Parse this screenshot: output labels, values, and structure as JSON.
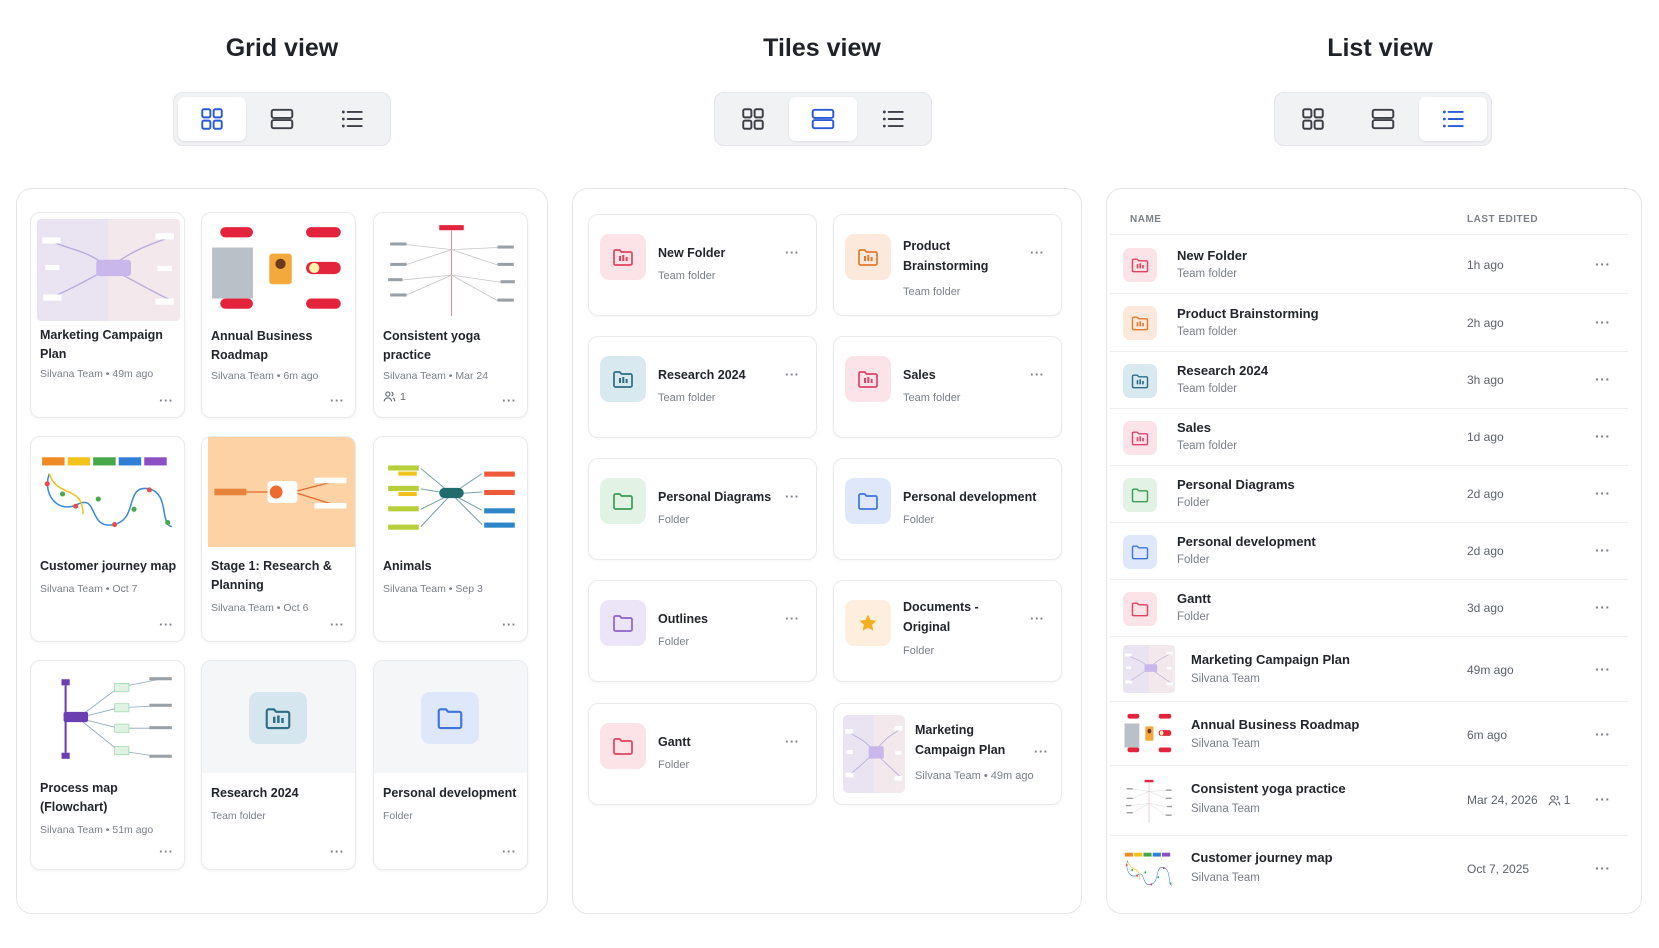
{
  "columns": {
    "grid": {
      "title": "Grid view"
    },
    "tiles": {
      "title": "Tiles view"
    },
    "list": {
      "title": "List view"
    }
  },
  "view_switcher": {
    "options": [
      "grid",
      "tiles",
      "list"
    ],
    "icons": [
      "grid-view-icon",
      "tiles-view-icon",
      "list-view-icon"
    ],
    "active_color": "#2a5bd7",
    "inactive_color": "#3b3f46"
  },
  "colors": {
    "red_folder": "#e0435e",
    "orange_folder": "#e07a2e",
    "teal_folder": "#2d6e87",
    "green_folder": "#3a9a56",
    "blue_folder": "#3f74d8",
    "purple_folder": "#8c63c9",
    "star": "#f2b01e"
  },
  "grid_view": {
    "cards": [
      {
        "title": "Marketing Campaign Plan",
        "meta": "Silvana Team • 49m ago"
      },
      {
        "title": "Annual Business Roadmap",
        "meta": "Silvana Team • 6m ago"
      },
      {
        "title": "Consistent yoga practice",
        "meta": "Silvana Team • Mar 24",
        "shared": "1"
      },
      {
        "title": "Customer journey map",
        "meta": "Silvana Team • Oct 7"
      },
      {
        "title": "Stage 1: Research & Planning",
        "meta": "Silvana Team • Oct 6"
      },
      {
        "title": "Animals",
        "meta": "Silvana Team • Sep 3"
      },
      {
        "title": "Process map (Flowchart)",
        "meta": "Silvana Team • 51m ago"
      },
      {
        "title": "Research 2024",
        "meta": "Team folder"
      },
      {
        "title": "Personal development",
        "meta": "Folder"
      }
    ]
  },
  "tiles_view": {
    "tiles": [
      {
        "title": "New Folder",
        "meta": "Team folder"
      },
      {
        "title": "Product Brainstorming",
        "meta": "Team folder"
      },
      {
        "title": "Research 2024",
        "meta": "Team folder"
      },
      {
        "title": "Sales",
        "meta": "Team folder"
      },
      {
        "title": "Personal Diagrams",
        "meta": "Folder"
      },
      {
        "title": "Personal development",
        "meta": "Folder"
      },
      {
        "title": "Outlines",
        "meta": "Folder"
      },
      {
        "title": "Documents - Original",
        "meta": "Folder"
      },
      {
        "title": "Gantt",
        "meta": "Folder"
      },
      {
        "title": "Marketing Campaign Plan",
        "meta": "Silvana Team • 49m ago"
      }
    ]
  },
  "list_view": {
    "headers": {
      "name": "NAME",
      "last_edited": "LAST EDITED"
    },
    "rows": [
      {
        "name": "New Folder",
        "sub": "Team folder",
        "edited": "1h ago"
      },
      {
        "name": "Product Brainstorming",
        "sub": "Team folder",
        "edited": "2h ago"
      },
      {
        "name": "Research 2024",
        "sub": "Team folder",
        "edited": "3h ago"
      },
      {
        "name": "Sales",
        "sub": "Team folder",
        "edited": "1d ago"
      },
      {
        "name": "Personal Diagrams",
        "sub": "Folder",
        "edited": "2d ago"
      },
      {
        "name": "Personal development",
        "sub": "Folder",
        "edited": "2d ago"
      },
      {
        "name": "Gantt",
        "sub": "Folder",
        "edited": "3d ago"
      },
      {
        "name": "Marketing Campaign Plan",
        "sub": "Silvana Team",
        "edited": "49m ago"
      },
      {
        "name": "Annual Business Roadmap",
        "sub": "Silvana Team",
        "edited": "6m ago"
      },
      {
        "name": "Consistent yoga practice",
        "sub": "Silvana Team",
        "edited": "Mar 24, 2026",
        "shared": "1"
      },
      {
        "name": "Customer journey map",
        "sub": "Silvana Team",
        "edited": "Oct 7, 2025"
      }
    ]
  },
  "more_menu": "···"
}
